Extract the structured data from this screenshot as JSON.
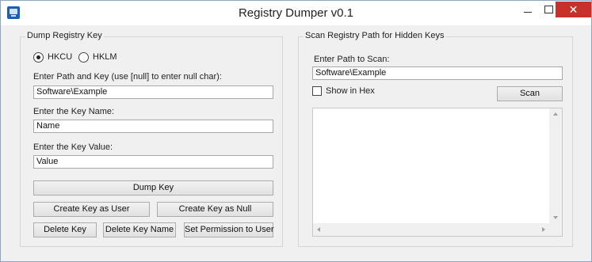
{
  "window": {
    "title": "Registry Dumper v0.1",
    "minimize_icon": "minimize-icon",
    "maximize_icon": "maximize-icon",
    "close_glyph": "✕"
  },
  "dump_group": {
    "title": "Dump Registry Key",
    "hive_options": [
      {
        "label": "HKCU",
        "checked": true
      },
      {
        "label": "HKLM",
        "checked": false
      }
    ],
    "path_label": "Enter Path and Key (use [null] to enter null char):",
    "path_value": "Software\\Example",
    "key_name_label": "Enter the Key Name:",
    "key_name_value": "Name",
    "key_value_label": "Enter the Key Value:",
    "key_value_value": "Value",
    "buttons": {
      "dump_key": "Dump Key",
      "create_key_as_user": "Create Key as User",
      "create_key_as_null": "Create Key as Null",
      "delete_key": "Delete Key",
      "delete_key_name": "Delete Key Name",
      "set_permission": "Set Permission to User"
    }
  },
  "scan_group": {
    "title": "Scan Registry Path for Hidden Keys",
    "path_label": "Enter Path to Scan:",
    "path_value": "Software\\Example",
    "show_in_hex_label": "Show in Hex",
    "show_in_hex_checked": false,
    "scan_button": "Scan",
    "results": []
  }
}
